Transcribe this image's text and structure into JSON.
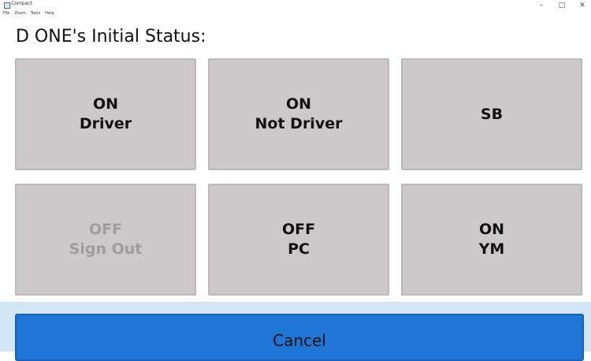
{
  "window": {
    "title": "Compact",
    "menu": [
      "File",
      "Zoom",
      "Tools",
      "Help"
    ],
    "controls": {
      "minimize": "–",
      "maximize": "□",
      "close": "✕"
    }
  },
  "page": {
    "title": "D ONE's Initial Status:"
  },
  "buttons": [
    {
      "line1": "ON",
      "line2": "Driver",
      "enabled": true
    },
    {
      "line1": "ON",
      "line2": "Not Driver",
      "enabled": true
    },
    {
      "line1": "SB",
      "line2": "",
      "enabled": true
    },
    {
      "line1": "OFF",
      "line2": "Sign Out",
      "enabled": false
    },
    {
      "line1": "OFF",
      "line2": "PC",
      "enabled": true
    },
    {
      "line1": "ON",
      "line2": "YM",
      "enabled": true
    }
  ],
  "footer": {
    "cancel_label": "Cancel"
  },
  "colors": {
    "button_bg": "#cdc9cb",
    "cancel_bg": "#1f76d7",
    "footer_bg": "#d3e6f5",
    "disabled_text": "#a09c9e"
  }
}
